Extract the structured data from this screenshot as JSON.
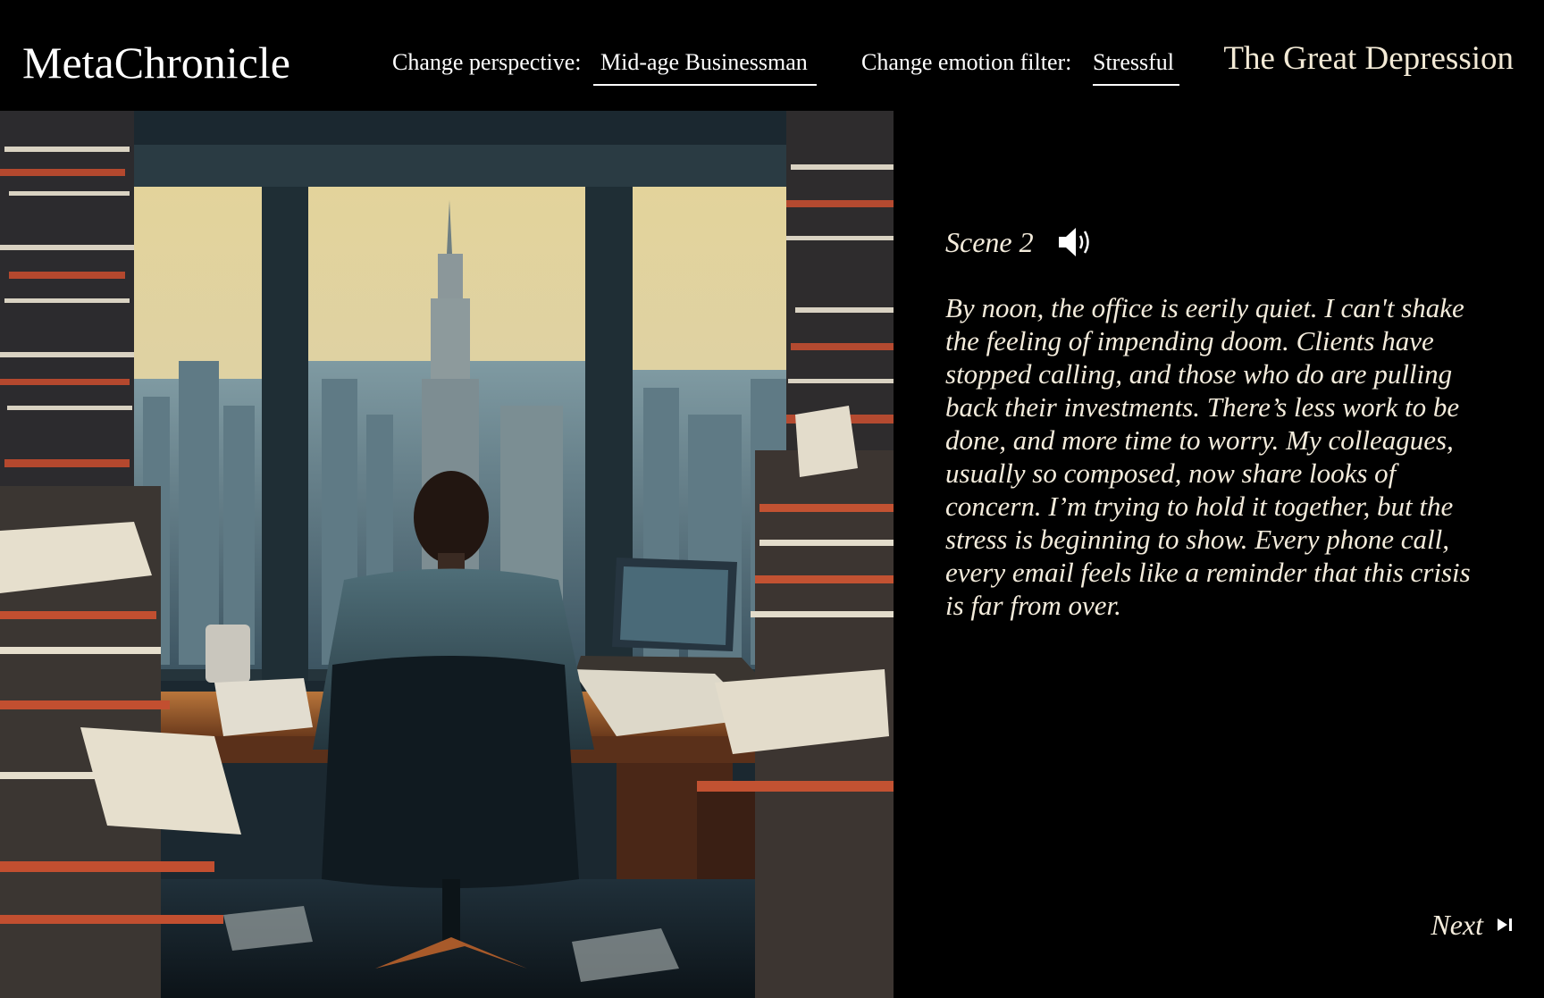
{
  "app": {
    "brand": "MetaChronicle",
    "era_title": "The Great Depression"
  },
  "controls": {
    "perspective": {
      "label": "Change perspective:",
      "value": "Mid-age Businessman"
    },
    "emotion": {
      "label": "Change emotion filter:",
      "value": "Stressful"
    }
  },
  "scene": {
    "label": "Scene 2",
    "audio_icon": "speaker-icon",
    "text": "By noon, the office is eerily quiet. I can't shake the feeling of impending doom. Clients have stopped calling, and those who do are pulling back their investments. There’s less work to be done, and more time to worry. My colleagues, usually so composed, now share looks of concern. I’m trying to hold it together, but the stress is beginning to show. Every phone call, every email feels like a reminder that this crisis is far from over."
  },
  "navigation": {
    "next_label": "Next",
    "next_icon": "skip-next-icon"
  },
  "colors": {
    "background": "#000000",
    "text_cream": "#f4ecdc",
    "text_white": "#ffffff"
  }
}
